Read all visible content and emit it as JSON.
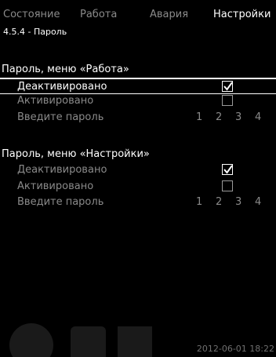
{
  "tabs": [
    {
      "label": "Состояние",
      "active": false
    },
    {
      "label": "Работа",
      "active": false
    },
    {
      "label": "Авария",
      "active": false
    },
    {
      "label": "Настройки",
      "active": true
    }
  ],
  "breadcrumb": "4.5.4 - Пароль",
  "sections": [
    {
      "title": "Пароль, меню «Работа»",
      "rows": [
        {
          "label": "Деактивировано",
          "checked": true,
          "selected": true
        },
        {
          "label": "Активировано",
          "checked": false,
          "selected": false
        }
      ],
      "password_label": "Введите пароль",
      "digits": [
        "1",
        "2",
        "3",
        "4"
      ]
    },
    {
      "title": "Пароль, меню «Настройки»",
      "rows": [
        {
          "label": "Деактивировано",
          "checked": true,
          "selected": false
        },
        {
          "label": "Активировано",
          "checked": false,
          "selected": false
        }
      ],
      "password_label": "Введите пароль",
      "digits": [
        "1",
        "2",
        "3",
        "4"
      ]
    }
  ],
  "footer": {
    "datetime": "2012-06-01 18:22"
  },
  "colors": {
    "background": "#000000",
    "text_active": "#ffffff",
    "text_inactive": "#8a8a8a",
    "watermark": "#1a1a1a"
  }
}
